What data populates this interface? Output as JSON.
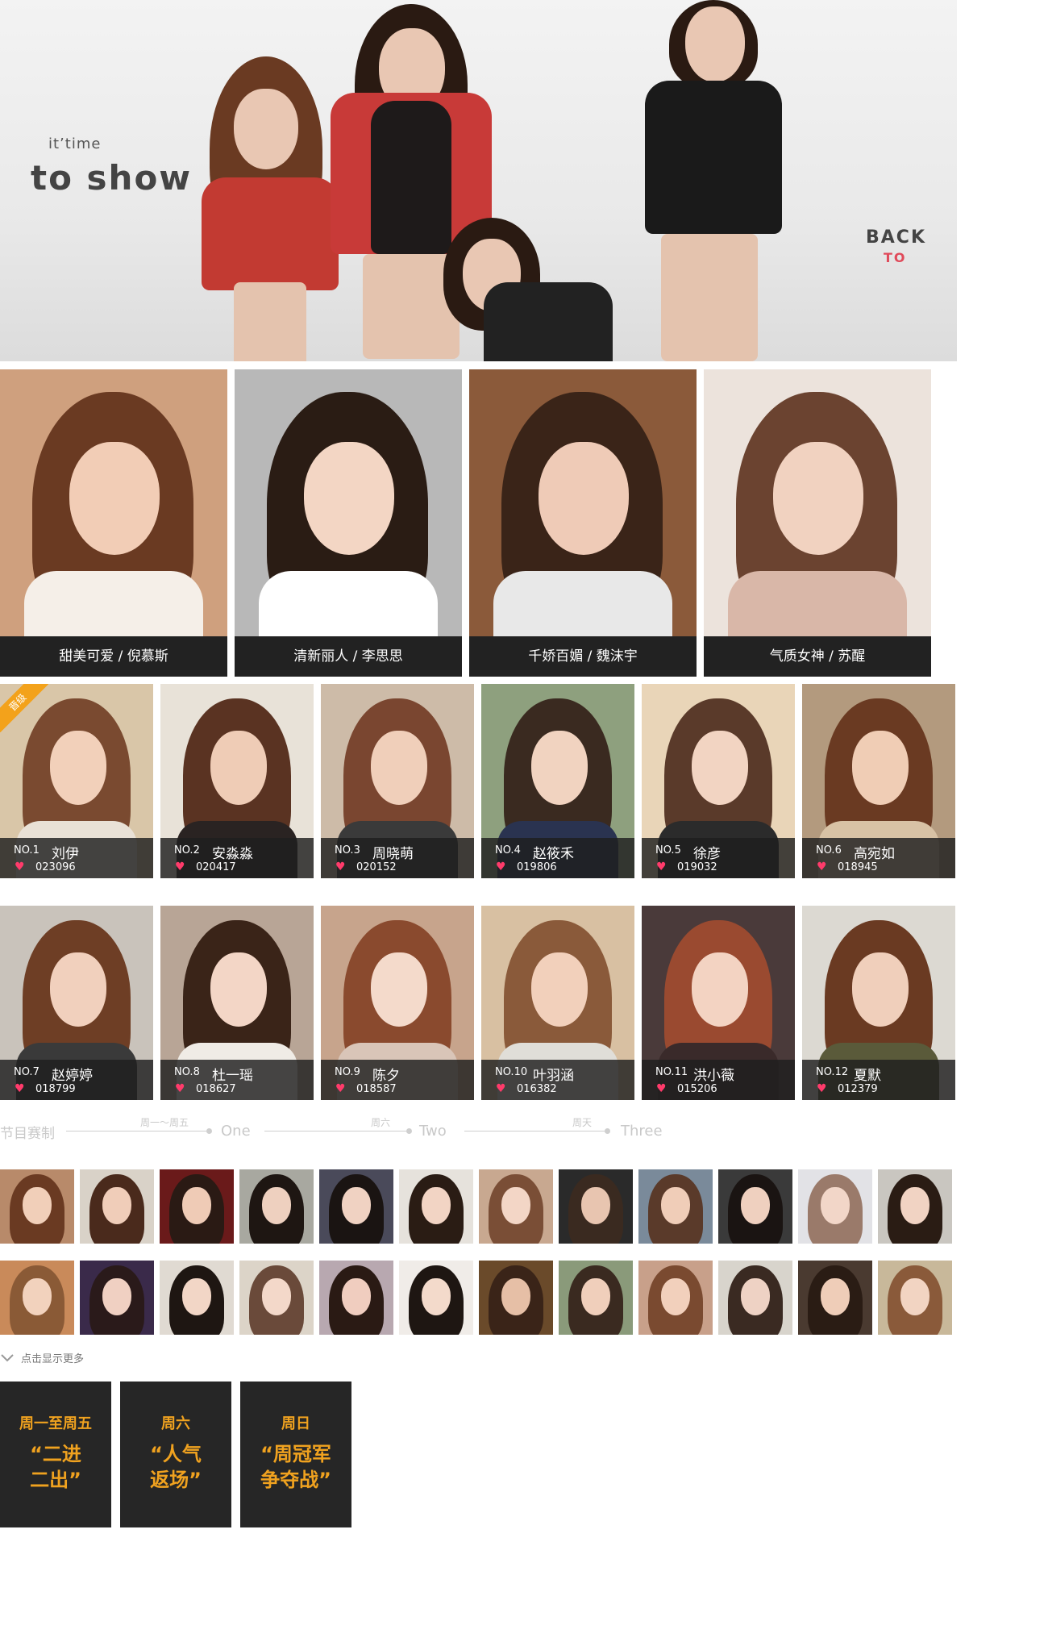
{
  "hero": {
    "subtitle": "it’time",
    "title": "to show",
    "back_label": "BACK",
    "to_label": "TO"
  },
  "featured": [
    {
      "label": "甜美可爱 / 倪慕斯",
      "bg": "#cfa07e",
      "hair": "#6a3a22",
      "face": "#f2cdb6",
      "cloth": "#f5efe8"
    },
    {
      "label": "清新丽人 / 李思思",
      "bg": "#b8b8b8",
      "hair": "#2a1c14",
      "face": "#f3d6c4",
      "cloth": "#ffffff"
    },
    {
      "label": "千娇百媚 / 魏沫宇",
      "bg": "#8b5a3a",
      "hair": "#3a2418",
      "face": "#efcbb7",
      "cloth": "#e8e8e8"
    },
    {
      "label": "气质女神 / 苏醒",
      "bg": "#ece3dc",
      "hair": "#6b4330",
      "face": "#f1d2c0",
      "cloth": "#d9b7a8"
    }
  ],
  "ranking": [
    {
      "rank": "NO.1",
      "name": "刘伊",
      "votes": "023096",
      "bg": "#d9c6a8",
      "hair": "#7a4a30",
      "face": "#f2d0ba",
      "cloth": "#e9e1d6",
      "badge": "晋级"
    },
    {
      "rank": "NO.2",
      "name": "安淼淼",
      "votes": "020417",
      "bg": "#e8e2d8",
      "hair": "#5a3322",
      "face": "#efccb6",
      "cloth": "#2a2322"
    },
    {
      "rank": "NO.3",
      "name": "周晓萌",
      "votes": "020152",
      "bg": "#cdbba8",
      "hair": "#7a4630",
      "face": "#f0cfba",
      "cloth": "#3a3a3a"
    },
    {
      "rank": "NO.4",
      "name": "赵筱禾",
      "votes": "019806",
      "bg": "#8ea07e",
      "hair": "#3a2a20",
      "face": "#f1d3c0",
      "cloth": "#2a3350"
    },
    {
      "rank": "NO.5",
      "name": "徐彦",
      "votes": "019032",
      "bg": "#e9d5b8",
      "hair": "#5a3a2a",
      "face": "#f2d4c2",
      "cloth": "#2b2b2b"
    },
    {
      "rank": "NO.6",
      "name": "高宛如",
      "votes": "018945",
      "bg": "#b39a7e",
      "hair": "#6a3a22",
      "face": "#f0cdb5",
      "cloth": "#d8c2a5"
    },
    {
      "rank": "NO.7",
      "name": "赵婷婷",
      "votes": "018799",
      "bg": "#c9c3bb",
      "hair": "#6e3e25",
      "face": "#f1d0bd",
      "cloth": "#3a3a3a"
    },
    {
      "rank": "NO.8",
      "name": "杜一瑶",
      "votes": "018627",
      "bg": "#b8a596",
      "hair": "#3a2418",
      "face": "#f3d6c6",
      "cloth": "#f0ece6"
    },
    {
      "rank": "NO.9",
      "name": "陈夕",
      "votes": "018587",
      "bg": "#c7a48c",
      "hair": "#8a4a2e",
      "face": "#f4dacb",
      "cloth": "#d9c5b8"
    },
    {
      "rank": "NO.10",
      "name": "叶羽涵",
      "votes": "016382",
      "bg": "#d8c0a2",
      "hair": "#8a5a3a",
      "face": "#f2d0bb",
      "cloth": "#e0ded8"
    },
    {
      "rank": "NO.11",
      "name": "洪小薇",
      "votes": "015206",
      "bg": "#4a3a3a",
      "hair": "#9a4a30",
      "face": "#f3d3c2",
      "cloth": "#3a2a2a"
    },
    {
      "rank": "NO.12",
      "name": "夏默",
      "votes": "012379",
      "bg": "#dcd9d2",
      "hair": "#6a3a22",
      "face": "#f0cfbb",
      "cloth": "#5a5a3a"
    }
  ],
  "timeline": {
    "title": "节目赛制",
    "stages": [
      {
        "day": "周一～周五",
        "word": "One"
      },
      {
        "day": "周六",
        "word": "Two"
      },
      {
        "day": "周天",
        "word": "Three"
      }
    ]
  },
  "thumbs": [
    {
      "bg": "#b88a6a",
      "hair": "#6a3a22",
      "face": "#f1cfb9"
    },
    {
      "bg": "#d9d2c8",
      "hair": "#4a2a1c",
      "face": "#f0cdb9"
    },
    {
      "bg": "#6a1a1a",
      "hair": "#2a1a14",
      "face": "#efcbb6"
    },
    {
      "bg": "#a8a8a0",
      "hair": "#1e1612",
      "face": "#eed0bf"
    },
    {
      "bg": "#4a4a5a",
      "hair": "#1a1412",
      "face": "#f0d2c2"
    },
    {
      "bg": "#e6e2dc",
      "hair": "#2a1c14",
      "face": "#f2d4c4"
    },
    {
      "bg": "#c8a890",
      "hair": "#7a4e36",
      "face": "#f3d6c6"
    },
    {
      "bg": "#2a2a2a",
      "hair": "#3a2a20",
      "face": "#e8c5b0"
    },
    {
      "bg": "#7a8a9a",
      "hair": "#5a3a2a",
      "face": "#f0cdb8"
    },
    {
      "bg": "#3a3a3a",
      "hair": "#1a1412",
      "face": "#efd0bf"
    },
    {
      "bg": "#e2e2e6",
      "hair": "#9a7a6a",
      "face": "#f2d6c8"
    },
    {
      "bg": "#c9c6c0",
      "hair": "#2a1c14",
      "face": "#f1d3c3"
    },
    {
      "bg": "#c98a5a",
      "hair": "#8a5a36",
      "face": "#f2d2bd"
    },
    {
      "bg": "#3a2a4a",
      "hair": "#2a1a1a",
      "face": "#f0d0c2"
    },
    {
      "bg": "#e0dad2",
      "hair": "#1e1612",
      "face": "#f2d6c6"
    },
    {
      "bg": "#dcd4c8",
      "hair": "#6a4a3a",
      "face": "#f3d8c9"
    },
    {
      "bg": "#b8a8b0",
      "hair": "#2a1a14",
      "face": "#f0cdbf"
    },
    {
      "bg": "#f0ece8",
      "hair": "#1e1612",
      "face": "#f3dacb"
    },
    {
      "bg": "#6a4a2a",
      "hair": "#3a2418",
      "face": "#e6bfa6"
    },
    {
      "bg": "#8a9a7a",
      "hair": "#3a2a20",
      "face": "#f0cfbb"
    },
    {
      "bg": "#c8a08a",
      "hair": "#7a4a30",
      "face": "#f2d0bc"
    },
    {
      "bg": "#d8d4cc",
      "hair": "#3a2a22",
      "face": "#eed2c4"
    },
    {
      "bg": "#4a3a30",
      "hair": "#2a1c14",
      "face": "#efcdb8"
    },
    {
      "bg": "#c8b89a",
      "hair": "#8a5a3a",
      "face": "#f2d4c2"
    }
  ],
  "more_label": "点击显示更多",
  "boxes": [
    {
      "day": "周一至周五",
      "line1": "“二进",
      "line2": "二出”"
    },
    {
      "day": "周六",
      "line1": "“人气",
      "line2": "返场”"
    },
    {
      "day": "周日",
      "line1": "“周冠军",
      "line2": "争夺战”"
    }
  ]
}
